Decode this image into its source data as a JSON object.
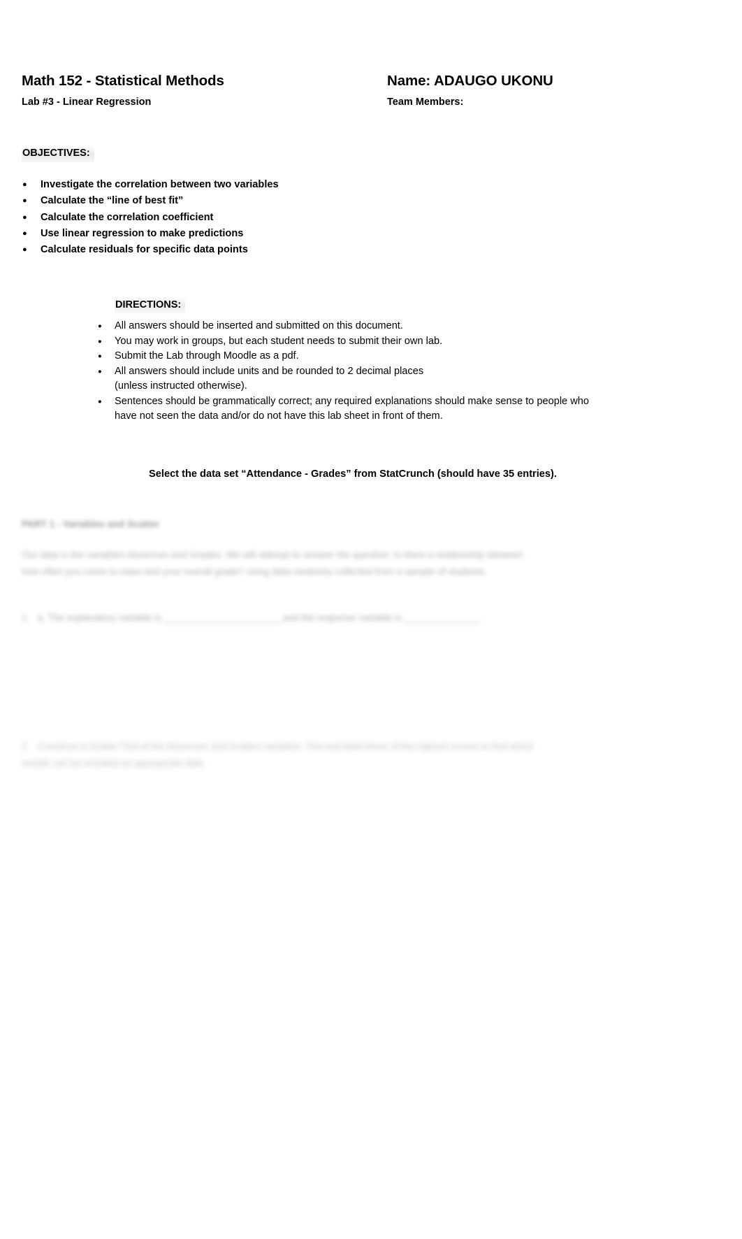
{
  "document": {
    "header": {
      "course_title": "Math 152 - Statistical Methods",
      "lab_subtitle": "Lab #3 - Linear Regression",
      "name_label": "Name: ADAUGO UKONU",
      "team_members_label": "Team Members:"
    },
    "objectives": {
      "heading": "OBJECTIVES:",
      "items": [
        "Investigate the correlation between two variables",
        "Calculate the “line of best fit”",
        "Calculate the correlation coefficient",
        "Use linear regression to make predictions",
        "Calculate residuals for specific data points"
      ]
    },
    "directions": {
      "heading": "DIRECTIONS:",
      "items": [
        "All answers should be inserted and submitted on this document.",
        "You may work in groups, but each student needs to submit their own lab.",
        "Submit the Lab through Moodle as a pdf.",
        "All answers should include units and be rounded to 2 decimal places\n(unless instructed otherwise).",
        "Sentences should be grammatically correct; any required explanations should make sense to people who have not seen the data and/or do not have this lab sheet in front of them."
      ]
    },
    "dataset_note": "Select the data set “Attendance - Grades” from StatCrunch (should have 35 entries).",
    "redacted": {
      "block_1_heading": "PART 1 - Variables and Scatter",
      "block_2_text": "Our data is the variables Absences and Grades. We will attempt to answer the question: Is there a relationship between how often you come to class and your overall grade? using data randomly collected from a sample of students.",
      "block_3_text": "1.   a. The explanatory variable is ______________________ and the response variable is ______________.",
      "block_4_text": "2.   Construct a Scatter Plot of the Absences and Grades variables. Plot and label three of the highest scores to find which results can be included as appropriate data."
    }
  },
  "colors": {
    "text": "#000000",
    "page_background": "#ffffff",
    "highlight_halo": "#d9d9d9",
    "redacted_text": "#3a3a3a"
  }
}
